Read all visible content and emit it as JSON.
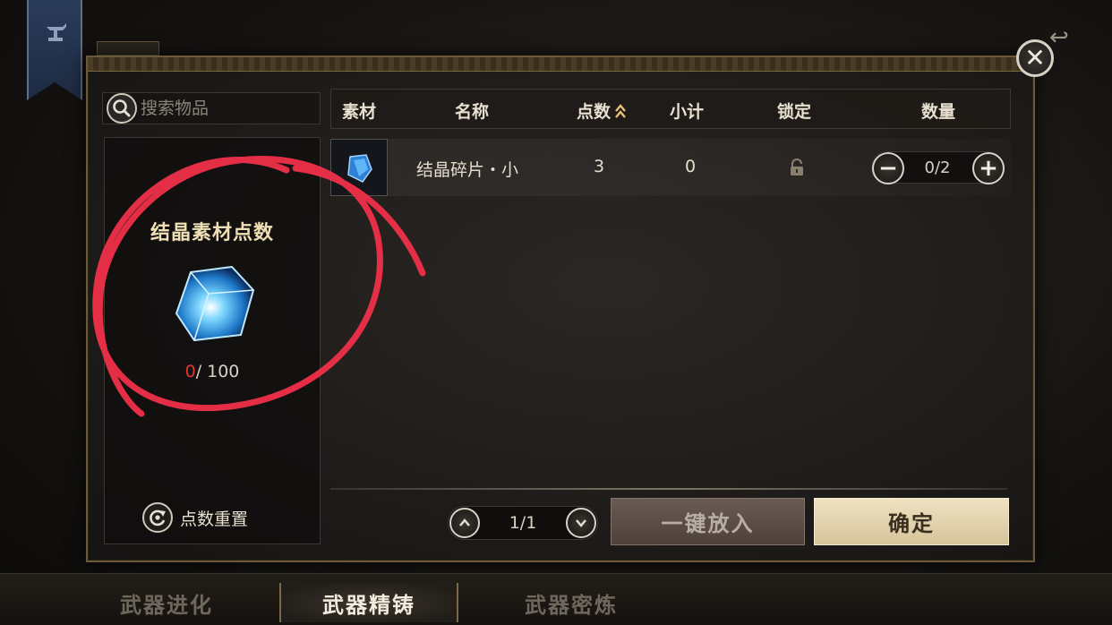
{
  "search": {
    "placeholder": "搜索物品"
  },
  "left_panel": {
    "title": "结晶素材点数",
    "points_current": "0",
    "points_total": "/ 100",
    "reset_label": "点数重置"
  },
  "table": {
    "columns": [
      "素材",
      "名称",
      "点数",
      "小计",
      "锁定",
      "数量"
    ],
    "rows": [
      {
        "name": "结晶碎片・小",
        "points": "3",
        "subtotal": "0",
        "quantity": "0/2",
        "locked": false
      }
    ]
  },
  "pagination": {
    "text": "1/1"
  },
  "buttons": {
    "auto_fill": "一键放入",
    "confirm": "确定"
  },
  "tabs": [
    {
      "label": "武器进化",
      "active": false
    },
    {
      "label": "武器精铸",
      "active": true
    },
    {
      "label": "武器密炼",
      "active": false
    }
  ],
  "colors": {
    "points_current": "#e2352c",
    "annotation": "#f0304a",
    "confirm_bg": "#e6d6b0"
  }
}
